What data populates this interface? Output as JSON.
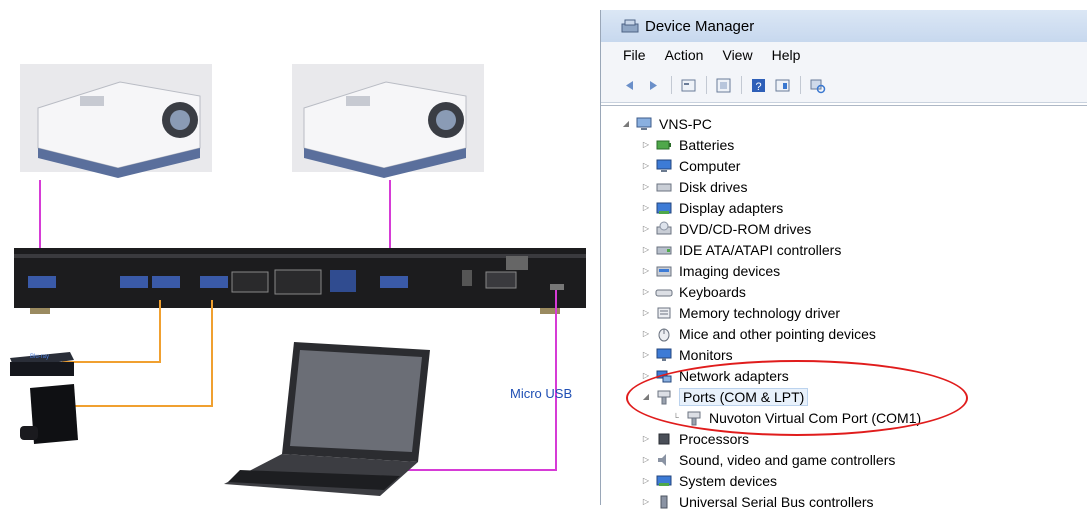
{
  "illustration": {
    "usb_label": "Micro USB"
  },
  "window": {
    "title": "Device Manager",
    "title_icon": "device-manager-icon"
  },
  "menu": [
    "File",
    "Action",
    "View",
    "Help"
  ],
  "toolbar_icons": [
    "back-icon",
    "forward-icon",
    "properties-icon",
    "update-icon",
    "help-icon",
    "details-icon",
    "scan-hardware-icon"
  ],
  "tree": {
    "root": "VNS-PC",
    "items": [
      {
        "label": "Batteries",
        "icon": "battery-icon",
        "expanded": false
      },
      {
        "label": "Computer",
        "icon": "computer-icon",
        "expanded": false
      },
      {
        "label": "Disk drives",
        "icon": "disk-drive-icon",
        "expanded": false
      },
      {
        "label": "Display adapters",
        "icon": "display-adapter-icon",
        "expanded": false
      },
      {
        "label": "DVD/CD-ROM drives",
        "icon": "dvd-icon",
        "expanded": false
      },
      {
        "label": "IDE ATA/ATAPI controllers",
        "icon": "ide-controller-icon",
        "expanded": false
      },
      {
        "label": "Imaging devices",
        "icon": "imaging-icon",
        "expanded": false
      },
      {
        "label": "Keyboards",
        "icon": "keyboard-icon",
        "expanded": false
      },
      {
        "label": "Memory technology driver",
        "icon": "memory-icon",
        "expanded": false
      },
      {
        "label": "Mice and other pointing devices",
        "icon": "mouse-icon",
        "expanded": false
      },
      {
        "label": "Monitors",
        "icon": "monitor-icon",
        "expanded": false
      },
      {
        "label": "Network adapters",
        "icon": "network-icon",
        "expanded": false
      },
      {
        "label": "Ports (COM & LPT)",
        "icon": "port-icon",
        "expanded": true,
        "selected": true,
        "children": [
          {
            "label": "Nuvoton Virtual Com Port (COM1)",
            "icon": "port-icon"
          }
        ]
      },
      {
        "label": "Processors",
        "icon": "processor-icon",
        "expanded": false
      },
      {
        "label": "Sound, video and game controllers",
        "icon": "sound-icon",
        "expanded": false
      },
      {
        "label": "System devices",
        "icon": "system-device-icon",
        "expanded": false
      },
      {
        "label": "Universal Serial Bus controllers",
        "icon": "usb-icon",
        "expanded": false
      }
    ]
  },
  "colors": {
    "highlight_ellipse": "#e01c1c",
    "usb_cable": "#d63bd6",
    "hdmi_cable": "#f0a030"
  }
}
